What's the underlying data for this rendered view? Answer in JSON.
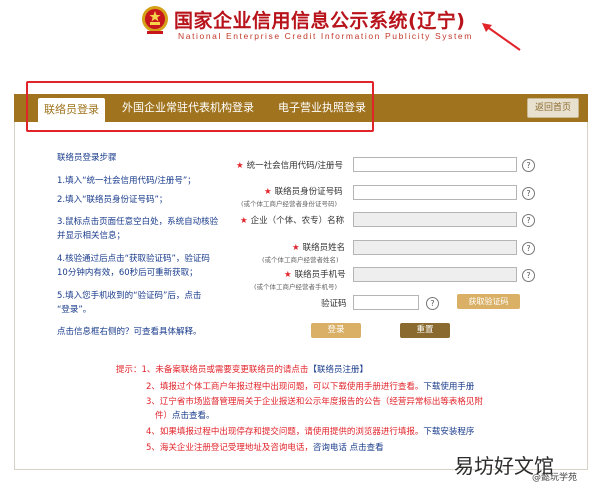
{
  "header": {
    "title": "国家企业信用信息公示系统",
    "region": "(辽宁)",
    "subtitle": "National Enterprise Credit Information Publicity System"
  },
  "tabs": [
    {
      "label": "联络员登录",
      "active": true
    },
    {
      "label": "外国企业常驻代表机构登录",
      "active": false
    },
    {
      "label": "电子营业执照登录",
      "active": false
    }
  ],
  "back_button": "返回首页",
  "steps": {
    "title": "联络员登录步骤",
    "items": [
      "1.填入“统一社会信用代码/注册号”；",
      "2.填入“联络员身份证号码”；",
      "3.鼠标点击页面任意空白处，系统自动核验",
      "并显示相关信息；",
      "4.核验通过后点击“获取验证码”，验证码",
      "10分钟内有效，60秒后可重新获取；",
      "5.填入您手机收到的“验证码”后，点击",
      "“登录”。",
      "点击信息框右侧的？可查看具体解释。"
    ]
  },
  "form": {
    "credit_code_label": "统一社会信用代码/注册号",
    "id_label": "联络员身份证号码",
    "id_sub": "(或个体工商户经营者身份证号码)",
    "company_label": "企业（个体、农专）名称",
    "name_label": "联络员姓名",
    "name_sub": "(或个体工商户经营者姓名)",
    "phone_label": "联络员手机号",
    "phone_sub": "(或个体工商户经营者手机号)",
    "code_label": "验证码",
    "get_code_button": "获取验证码",
    "help_glyph": "?",
    "login_button": "登录",
    "reset_button": "重置"
  },
  "tips": {
    "prefix": "提示：",
    "line1": "1、未备案联络员或需要变更联络员的请点击",
    "line1_link": "【联络员注册】",
    "line2": "2、填报过个体工商户年报过程中出现问题，可以下载使用手册进行查看。",
    "line2_link": "下载使用手册",
    "line3a": "3、辽宁省市场监督管理局关于企业报送和公示年度报告的公告（经营异常标出等表格见附",
    "line3b": "件）",
    "line3b_link": "点击查看。",
    "line4": "4、如果填报过程中出现停存和提交问题，请使用提供的浏览器进行填报。",
    "line4_link": "下载安装程序",
    "line5": "5、海关企业注册登记受理地址及咨询电话，",
    "line5_link": "咨询电话 点击查看"
  },
  "watermark": {
    "big": "易坊好文馆",
    "small": "@懿玩学苑"
  }
}
